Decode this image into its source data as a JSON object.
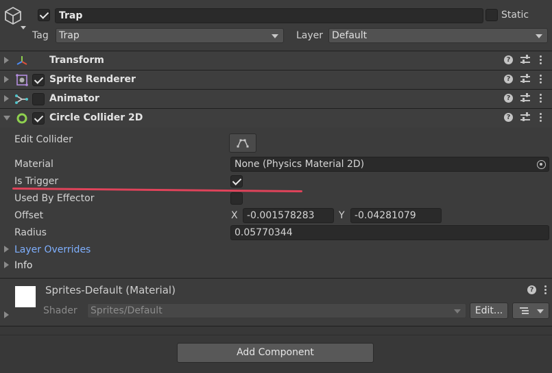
{
  "gameobject": {
    "name": "Trap",
    "active": true,
    "static_label": "Static",
    "static_checked": false,
    "tag_label": "Tag",
    "tag_value": "Trap",
    "layer_label": "Layer",
    "layer_value": "Default"
  },
  "components": [
    {
      "name": "Transform",
      "icon": "transform-axes-icon",
      "has_checkbox": false,
      "expanded": false
    },
    {
      "name": "Sprite Renderer",
      "icon": "sprite-renderer-icon",
      "has_checkbox": true,
      "checked": true,
      "expanded": false
    },
    {
      "name": "Animator",
      "icon": "animator-icon",
      "has_checkbox": true,
      "checked": false,
      "expanded": false
    },
    {
      "name": "Circle Collider 2D",
      "icon": "circle-collider-icon",
      "has_checkbox": true,
      "checked": true,
      "expanded": true
    }
  ],
  "collider": {
    "edit_collider_label": "Edit Collider",
    "material_label": "Material",
    "material_value": "None (Physics Material 2D)",
    "is_trigger_label": "Is Trigger",
    "is_trigger": true,
    "used_by_effector_label": "Used By Effector",
    "used_by_effector": false,
    "offset_label": "Offset",
    "offset_x_label": "X",
    "offset_x": "-0.001578283",
    "offset_y_label": "Y",
    "offset_y": "-0.04281079",
    "radius_label": "Radius",
    "radius": "0.05770344",
    "layer_overrides_label": "Layer Overrides",
    "info_label": "Info"
  },
  "material": {
    "name": "Sprites-Default (Material)",
    "shader_label": "Shader",
    "shader_value": "Sprites/Default",
    "edit_label": "Edit..."
  },
  "add_component_label": "Add Component",
  "colors": {
    "background": "#3c3c3c",
    "link": "#7fb0ff",
    "annotation_underline": "#e0435a"
  }
}
